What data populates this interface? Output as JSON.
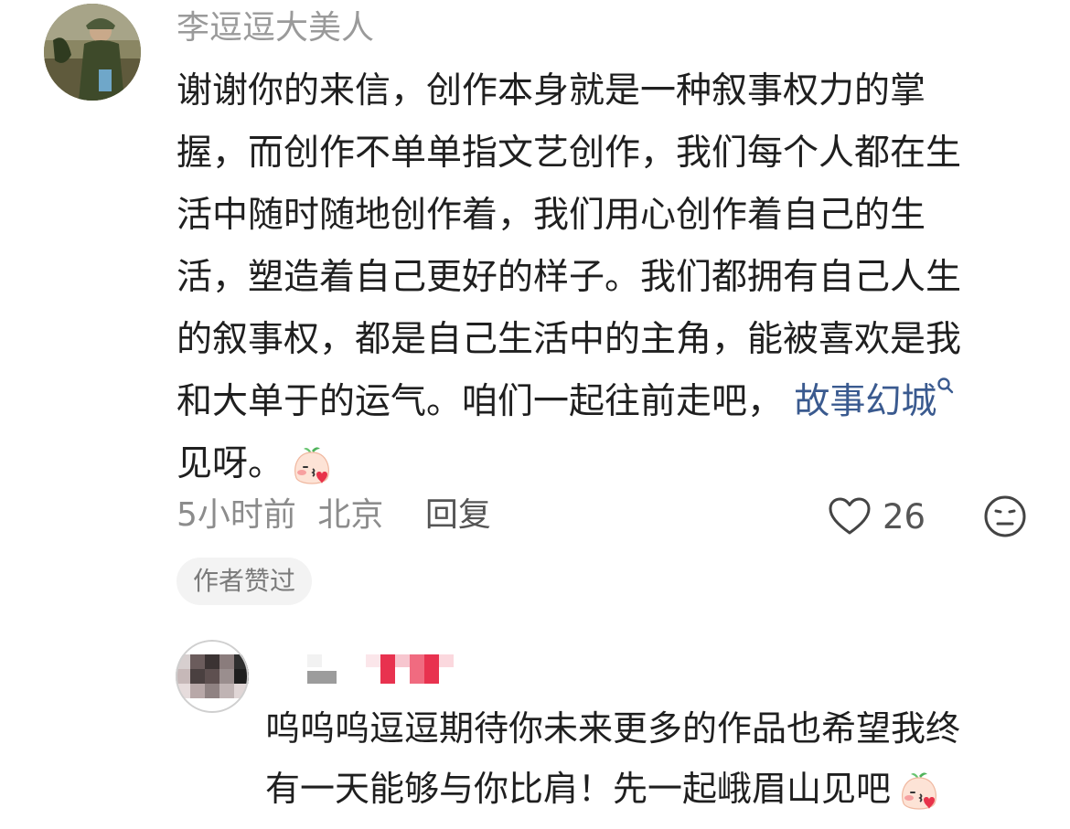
{
  "comment": {
    "username": "李逗逗大美人",
    "lines": [
      "谢谢你的来信，创作本身就是一种叙事权力的掌",
      "握，而创作不单单指文艺创作，我们每个人都在生",
      "活中随时随地创作着，我们用心创作着自己的生",
      "活，塑造着自己更好的样子。我们都拥有自己人生",
      "的叙事权，都是自己生活中的主角，能被喜欢是我"
    ],
    "line6_text": "和大单于的运气。咱们一起往前走吧，",
    "topic_link": "故事幻城",
    "line7_text": "见呀。",
    "time": "5小时前",
    "location": "北京",
    "reply_label": "回复",
    "like_count": "26",
    "author_liked_badge": "作者赞过",
    "icons": [
      "search-icon",
      "peach-blush-emoji",
      "heart-outline-icon",
      "neutral-face-icon"
    ]
  },
  "reply": {
    "lines": [
      "呜呜呜逗逗期待你未来更多的作品也希望我终",
      "有一天能够与你比肩！先一起峨眉山见吧"
    ]
  },
  "colors": {
    "link": "#3a5a8f",
    "muted_text": "#8c8c8c",
    "body_text": "#1f1f1f",
    "badge_bg": "#f3f3f3"
  }
}
